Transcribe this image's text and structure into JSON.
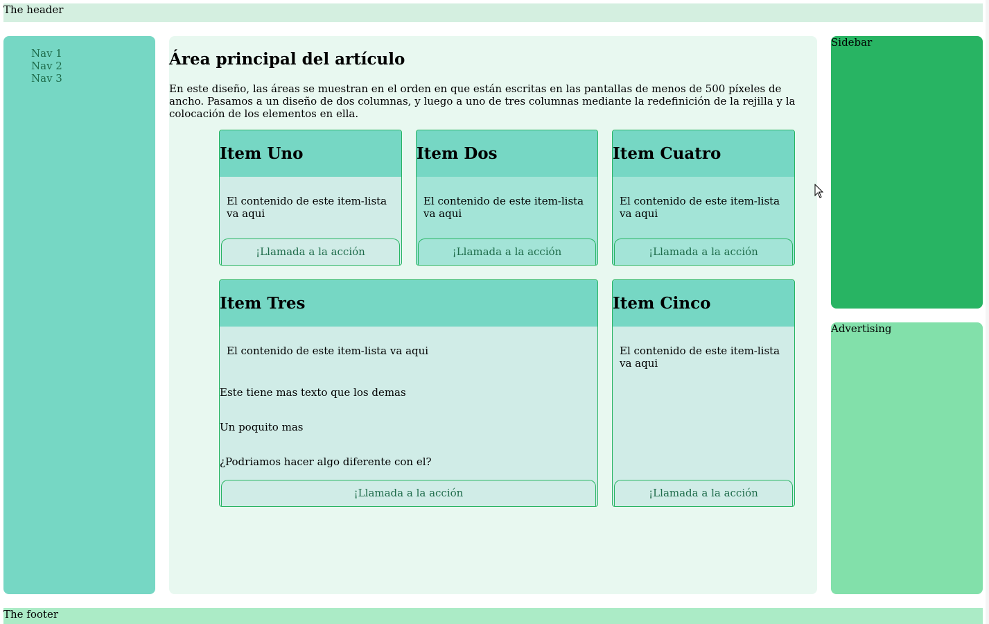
{
  "header": {
    "label": "The header"
  },
  "nav": {
    "items": [
      "Nav 1",
      "Nav 2",
      "Nav 3"
    ]
  },
  "article": {
    "title": "Área principal del artículo",
    "intro": "En este diseño, las áreas se muestran en el orden en que están escritas en las pantallas de menos de 500 píxeles de ancho. Pasamos a un diseño de dos columnas, y luego a uno de tres columnas mediante la redefinición de la rejilla y la colocación de los elementos en ella."
  },
  "cards": [
    {
      "title": "Item Uno",
      "body": "El contenido de este item-lista va aqui",
      "cta": "¡Llamada a la acción"
    },
    {
      "title": "Item Dos",
      "body": "El contenido de este item-lista va aqui",
      "cta": "¡Llamada a la acción"
    },
    {
      "title": "Item Cuatro",
      "body": "El contenido de este item-lista va aqui",
      "cta": "¡Llamada a la acción"
    },
    {
      "title": "Item Tres",
      "body": "El contenido de este item-lista va aqui",
      "extra": [
        "Este tiene mas texto que los demas",
        "Un poquito mas",
        "¿Podriamos hacer algo diferente con el?"
      ],
      "cta": "¡Llamada a la acción"
    },
    {
      "title": "Item Cinco",
      "body": "El contenido de este item-lista va aqui",
      "cta": "¡Llamada a la acción"
    }
  ],
  "sidebar": {
    "label": "Sidebar"
  },
  "advertising": {
    "label": "Advertising"
  },
  "footer": {
    "label": "The footer"
  },
  "colors": {
    "header_bg": "#d4efe0",
    "nav_bg": "#76d7c4",
    "article_bg": "#e8f8f0",
    "card_bg": "#d0ece7",
    "card_alt_bg": "#a3e4d7",
    "card_head_bg": "#76d7c4",
    "sidebar_bg": "#28b463",
    "ads_bg": "#82e0aa",
    "footer_bg": "#abebc6",
    "accent": "#27b462"
  }
}
